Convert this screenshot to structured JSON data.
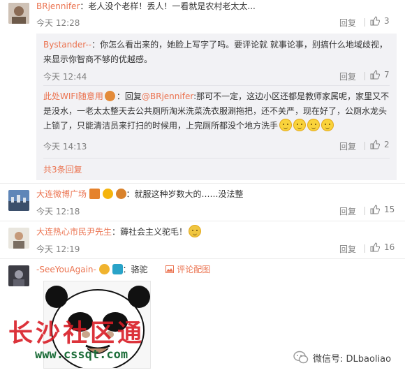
{
  "comments": [
    {
      "user": "BRjennifer",
      "sep": "：",
      "text": "老人没个老样！丢人！一看就是农村老太太...",
      "time": "今天 12:28",
      "reply": "回复",
      "likes": "3"
    },
    {
      "user": "大连微博广场",
      "sep": "：",
      "text": "就服这种岁数大的……没法整",
      "time": "今天 12:18",
      "reply": "回复",
      "likes": "15"
    },
    {
      "user": "大连热心市民尹先生",
      "sep": "：",
      "text": "薅社会主义驼毛！",
      "time": "今天 12:19",
      "reply": "回复",
      "likes": "16"
    },
    {
      "user": "-SeeYouAgain-",
      "sep": "：",
      "text": "骆驼",
      "time": "",
      "reply": "",
      "likes": ""
    }
  ],
  "subreplies": [
    {
      "user": "Bystander--",
      "sep": "：",
      "text_line1": "你怎么看出来的，她脸上写字了吗。要评论就 就事论事，别搞什么地域歧视，",
      "text_line2": "来显示你智商不够的优越感。",
      "time": "今天 12:44",
      "reply": "回复",
      "likes": "7"
    },
    {
      "user": "此处WIFI随意用",
      "sep": "：",
      "mention_prefix": "回复",
      "mention": "@BRjennifer",
      "text_line1": ":那可不一定，这边小区还都是教师家属呢，家里又不",
      "text_line2": "是没水，一老太太整天去公共厕所淘米洗菜洗衣服涮拖把，还不关严，现在好了，公厕水龙头",
      "text_line3": "上锁了，只能清洁员来打扫的时候用，上完厕所都没个地方洗手",
      "time": "今天 14:13",
      "reply": "回复",
      "likes": "2"
    }
  ],
  "more_replies": "共3条回复",
  "comment_image_link": "评论配图",
  "watermark": {
    "main": "长沙社区通",
    "url": "www.cssqt.com"
  },
  "wechat": {
    "label": "微信号: DLbaoliao"
  },
  "colors": {
    "accent": "#eb7350",
    "gray": "#808080",
    "subbox": "#f2f2f5"
  }
}
